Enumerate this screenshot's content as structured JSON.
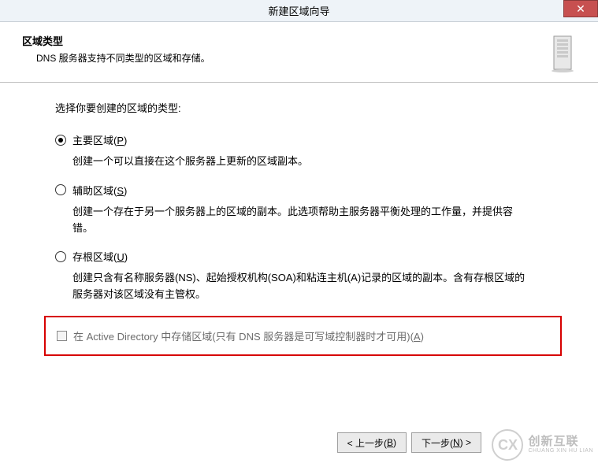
{
  "titlebar": {
    "title": "新建区域向导",
    "close_glyph": "✕"
  },
  "header": {
    "title": "区域类型",
    "subtitle": "DNS 服务器支持不同类型的区域和存储。"
  },
  "content": {
    "prompt": "选择你要创建的区域的类型:",
    "options": [
      {
        "label_pre": "主要区域(",
        "mnemonic": "P",
        "label_post": ")",
        "desc": "创建一个可以直接在这个服务器上更新的区域副本。",
        "selected": true
      },
      {
        "label_pre": "辅助区域(",
        "mnemonic": "S",
        "label_post": ")",
        "desc": "创建一个存在于另一个服务器上的区域的副本。此选项帮助主服务器平衡处理的工作量，并提供容错。",
        "selected": false
      },
      {
        "label_pre": "存根区域(",
        "mnemonic": "U",
        "label_post": ")",
        "desc": "创建只含有名称服务器(NS)、起始授权机构(SOA)和粘连主机(A)记录的区域的副本。含有存根区域的服务器对该区域没有主管权。",
        "selected": false
      }
    ],
    "ad_checkbox": {
      "label_pre": "在 Active Directory 中存储区域(只有 DNS 服务器是可写域控制器时才可用)(",
      "mnemonic": "A",
      "label_post": ")",
      "checked": false,
      "enabled": false
    }
  },
  "buttons": {
    "back_pre": "< 上一步(",
    "back_mnemonic": "B",
    "back_post": ")",
    "next_pre": "下一步(",
    "next_mnemonic": "N",
    "next_post": ") >"
  },
  "watermark": {
    "logo_text": "CX",
    "cn": "创新互联",
    "en": "CHUANG XIN HU LIAN"
  }
}
